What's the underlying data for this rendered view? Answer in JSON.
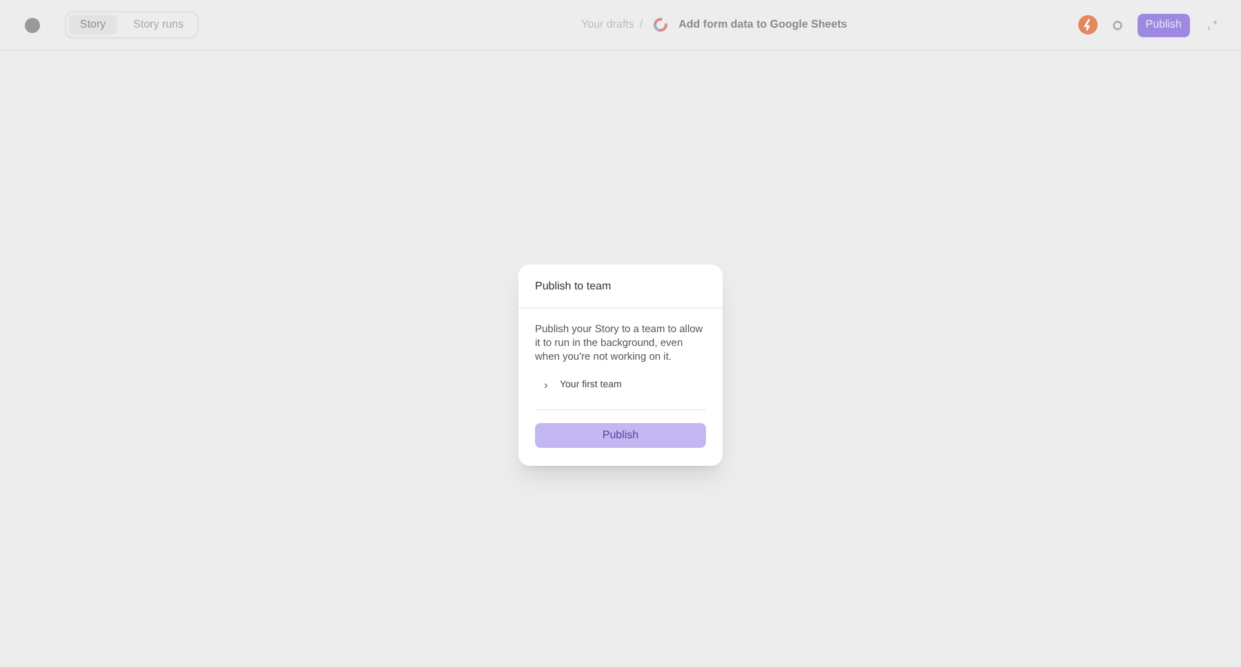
{
  "header": {
    "tabs": [
      {
        "label": "Story",
        "selected": true
      },
      {
        "label": "Story runs",
        "selected": false
      }
    ],
    "breadcrumb": {
      "parent": "Your drafts",
      "separator": "/",
      "title": "Add form data to Google Sheets"
    },
    "publish_button": "Publish"
  },
  "dialog": {
    "title": "Publish to team",
    "description": "Publish your Story to a team to allow it to run in the background, even when you're not working on it.",
    "teams": [
      {
        "chevron": "›",
        "name": "Your first team",
        "expanded": false
      }
    ],
    "publish_button": {
      "label": "Publish",
      "disabled": true
    }
  }
}
